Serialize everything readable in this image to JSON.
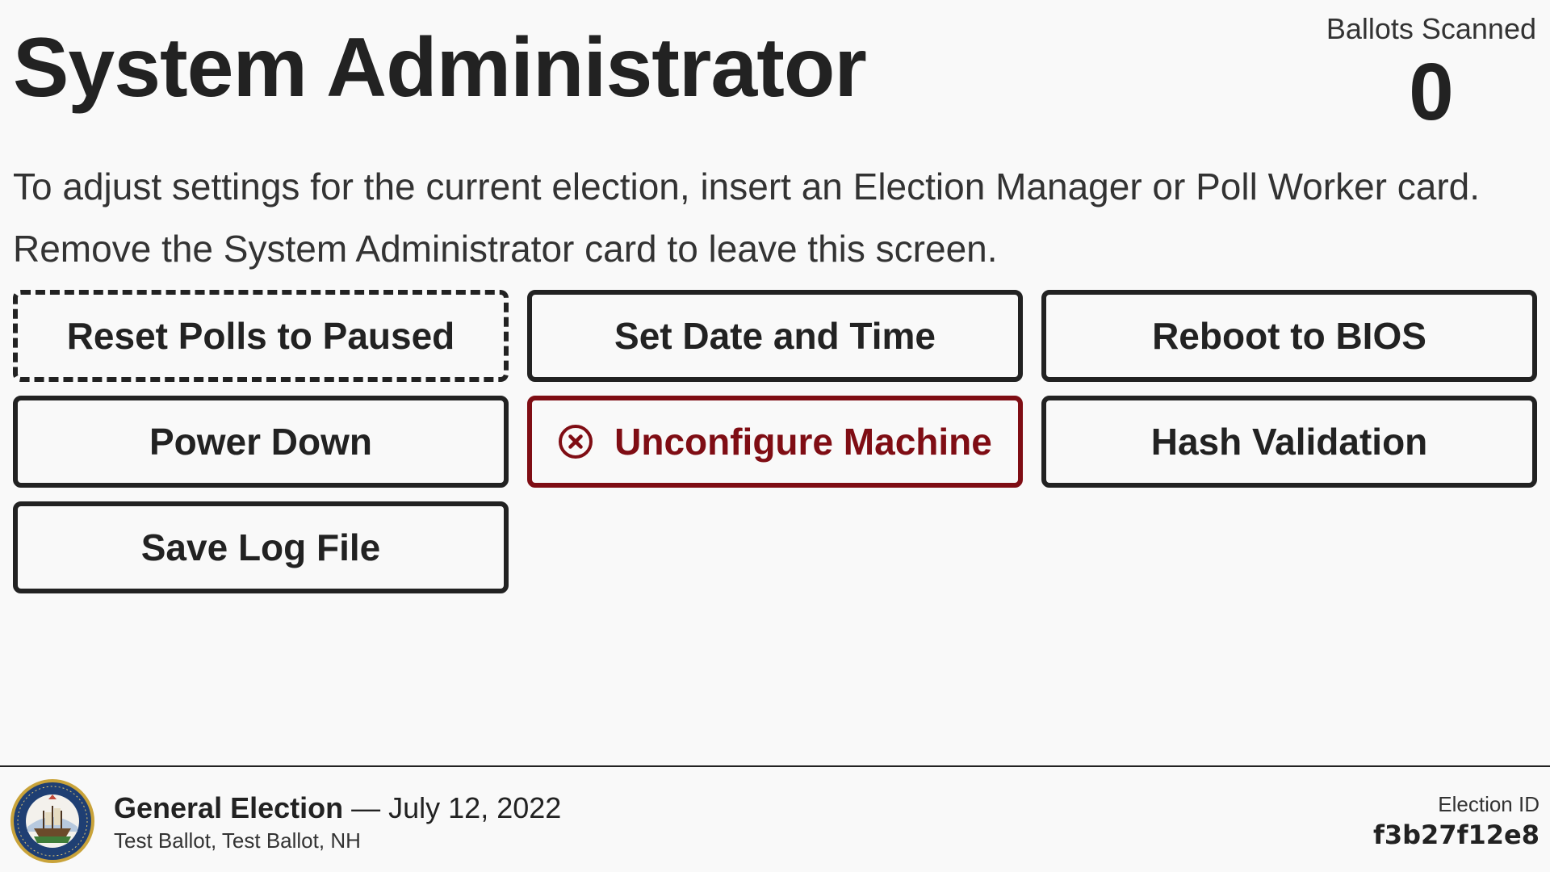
{
  "header": {
    "title": "System Administrator",
    "ballot_counter": {
      "label": "Ballots Scanned",
      "value": "0"
    }
  },
  "instructions": {
    "line1": "To adjust settings for the current election, insert an Election Manager or Poll Worker card.",
    "line2": "Remove the System Administrator card to leave this screen."
  },
  "actions": {
    "reset_polls": "Reset Polls to Paused",
    "set_date_time": "Set Date and Time",
    "reboot_bios": "Reboot to BIOS",
    "power_down": "Power Down",
    "unconfigure": "Unconfigure Machine",
    "unconfigure_icon": "circle-x-icon",
    "hash_validation": "Hash Validation",
    "save_log": "Save Log File"
  },
  "footer": {
    "election_title": "General Election",
    "separator": " — ",
    "election_date": "July 12, 2022",
    "ballot_info": "Test Ballot, Test Ballot, NH",
    "election_id_label": "Election ID",
    "election_id": "f3b27f12e8",
    "seal_icon": "state-seal-icon"
  },
  "colors": {
    "text": "#222222",
    "background": "#f9f9f9",
    "danger": "#7f0d14"
  }
}
